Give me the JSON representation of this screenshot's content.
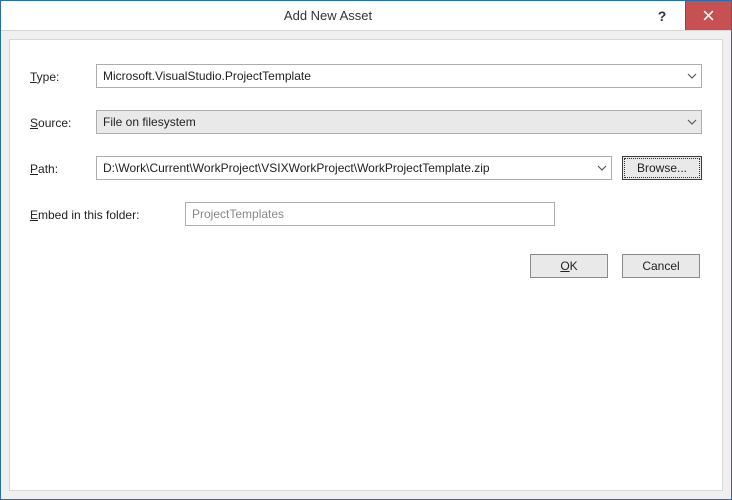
{
  "window": {
    "title": "Add New Asset",
    "help_tooltip": "Help"
  },
  "form": {
    "type_label": "Type:",
    "type_value": "Microsoft.VisualStudio.ProjectTemplate",
    "source_label": "Source:",
    "source_value": "File on filesystem",
    "path_label": "Path:",
    "path_value": "D:\\Work\\Current\\WorkProject\\VSIXWorkProject\\WorkProjectTemplate.zip",
    "browse_label": "Browse...",
    "embed_label": "Embed in this folder:",
    "embed_placeholder": "ProjectTemplates"
  },
  "actions": {
    "ok_label": "OK",
    "cancel_label": "Cancel"
  }
}
